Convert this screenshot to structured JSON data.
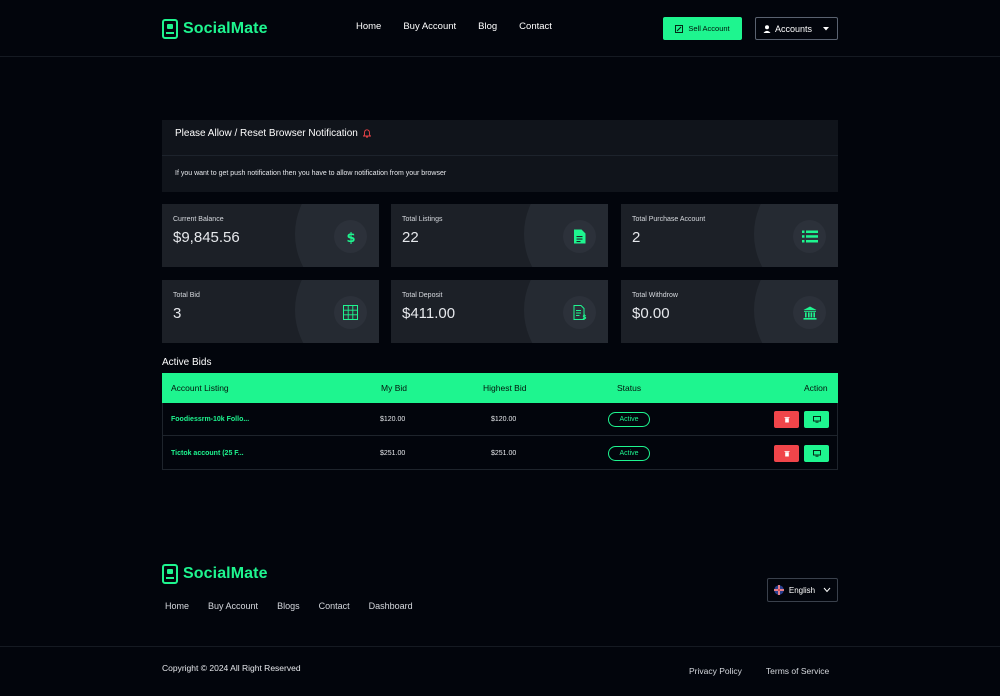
{
  "brand": {
    "name": "SocialMate",
    "accent": "#1ef58f"
  },
  "header": {
    "nav": [
      "Home",
      "Buy Account",
      "Blog",
      "Contact"
    ],
    "sell_label": "Sell Account",
    "accounts_label": "Accounts"
  },
  "notification": {
    "title": "Please Allow / Reset Browser Notification",
    "body": "If you want to get push notification then you have to allow notification from your browser"
  },
  "stats": [
    {
      "label": "Current Balance",
      "value": "$9,845.56",
      "icon": "dollar-icon"
    },
    {
      "label": "Total Listings",
      "value": "22",
      "icon": "document-icon"
    },
    {
      "label": "Total Purchase Account",
      "value": "2",
      "icon": "list-icon"
    },
    {
      "label": "Total Bid",
      "value": "3",
      "icon": "grid-icon"
    },
    {
      "label": "Total Deposit",
      "value": "$411.00",
      "icon": "invoice-icon"
    },
    {
      "label": "Total Withdrow",
      "value": "$0.00",
      "icon": "bank-icon"
    }
  ],
  "active_bids": {
    "title": "Active Bids",
    "columns": [
      "Account Listing",
      "My Bid",
      "Highest Bid",
      "Status",
      "Action"
    ],
    "rows": [
      {
        "listing": "Foodiessrm-10k Follo...",
        "my_bid": "$120.00",
        "highest_bid": "$120.00",
        "status": "Active"
      },
      {
        "listing": "Tictok account (25 F...",
        "my_bid": "$251.00",
        "highest_bid": "$251.00",
        "status": "Active"
      }
    ]
  },
  "footer": {
    "nav": [
      "Home",
      "Buy Account",
      "Blogs",
      "Contact",
      "Dashboard"
    ],
    "language": "English",
    "copyright": "Copyright © 2024 All Right Reserved",
    "legal": [
      "Privacy Policy",
      "Terms of Service"
    ]
  }
}
